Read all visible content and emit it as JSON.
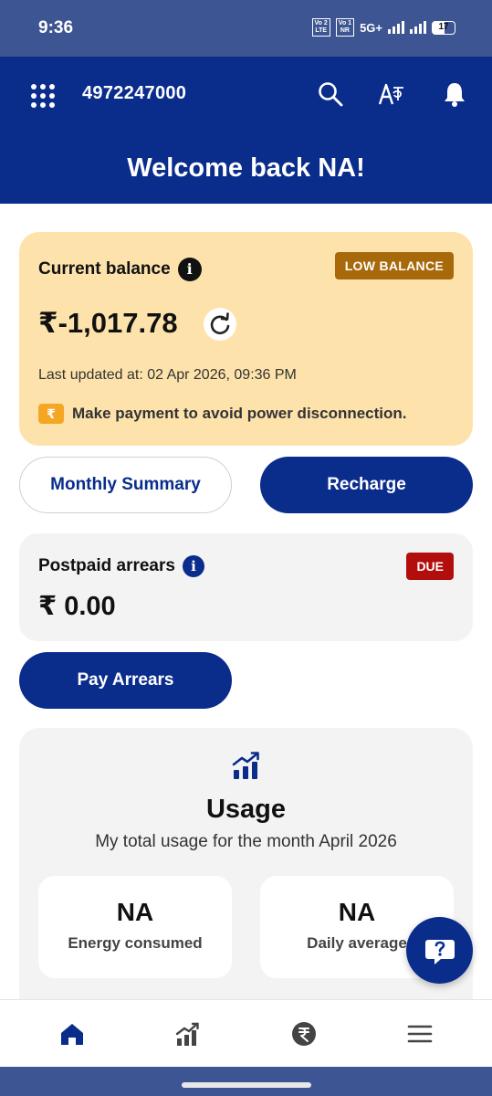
{
  "status_bar": {
    "time": "9:36",
    "volte1_top": "Vo 2",
    "volte1_bottom": "LTE",
    "volte2_top": "Vo 1",
    "volte2_bottom": "NR",
    "network": "5G+",
    "battery": "17"
  },
  "header": {
    "account_number": "4972247000",
    "welcome": "Welcome back NA!",
    "icons": [
      "apps-grid-icon",
      "search-icon",
      "language-icon",
      "bell-icon"
    ]
  },
  "balance": {
    "title": "Current balance",
    "badge": "LOW BALANCE",
    "amount": "₹-1,017.78",
    "last_updated": "Last updated at: 02 Apr 2026, 09:36 PM",
    "warning": "Make payment to avoid power disconnection.",
    "warning_icon_glyph": "₹"
  },
  "actions": {
    "monthly_summary": "Monthly Summary",
    "recharge": "Recharge"
  },
  "arrears": {
    "title": "Postpaid arrears",
    "badge": "DUE",
    "amount": "₹ 0.00",
    "pay_button": "Pay Arrears"
  },
  "usage": {
    "title": "Usage",
    "subtitle": "My total usage for the month April 2026",
    "stats": [
      {
        "value": "NA",
        "label": "Energy consumed"
      },
      {
        "value": "NA",
        "label": "Daily average"
      }
    ]
  },
  "info_glyph": "i",
  "bottom_nav": [
    "home-icon",
    "usage-chart-icon",
    "rupee-icon",
    "menu-icon"
  ],
  "colors": {
    "primary": "#0a2d8c",
    "balance_card_bg": "#fde3ab",
    "low_balance_badge": "#a8690a",
    "due_badge": "#b30e0e",
    "status_bar": "#3d5592"
  }
}
